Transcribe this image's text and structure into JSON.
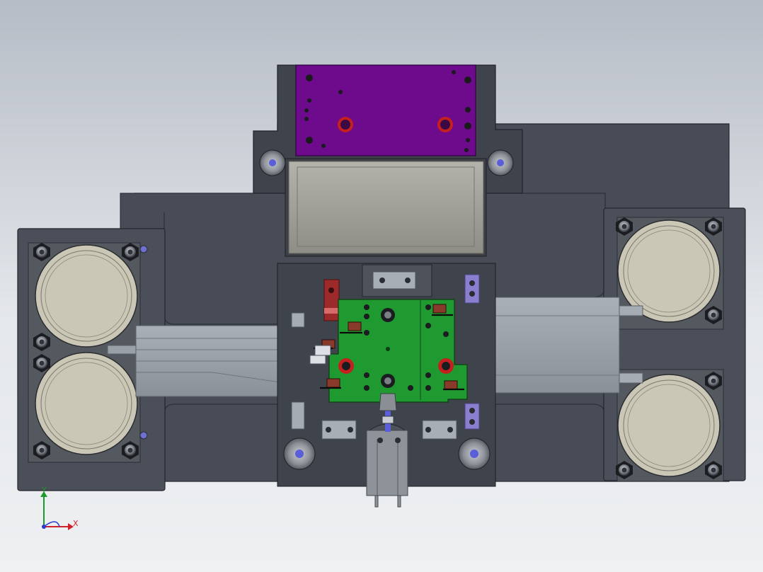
{
  "view": {
    "background_top": "#b6bcc6",
    "background_bottom": "#eef0f2"
  },
  "triad": {
    "x_label": "X",
    "y_label": "Y",
    "x_color": "#d0202a",
    "y_color": "#1a9a2a",
    "z_color": "#2a3ad0"
  },
  "colors": {
    "base_plate": "#474c57",
    "upper_block": "#3f434c",
    "purple_plate": "#6e0a8c",
    "green_carrier": "#1f9a30",
    "cylinder_body": "#5a5e68",
    "cylinder_face": "#cbc7b6",
    "rail": "#9ea3aa",
    "tray": "#9c9b93",
    "red_part": "#9c2a2a",
    "lavender_block": "#8a7fcf"
  },
  "components": [
    {
      "id": "left-top-cylinder"
    },
    {
      "id": "left-bottom-cylinder"
    },
    {
      "id": "right-top-cylinder"
    },
    {
      "id": "right-bottom-cylinder"
    },
    {
      "id": "purple-top-plate"
    },
    {
      "id": "hopper-tray"
    },
    {
      "id": "green-carrier-plate"
    },
    {
      "id": "bottom-guide-pins"
    }
  ]
}
